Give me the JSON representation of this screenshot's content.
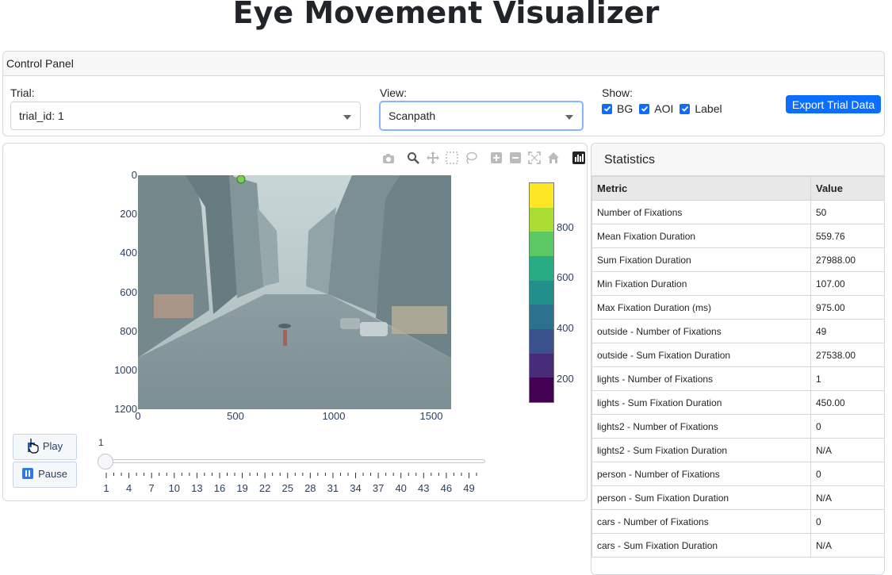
{
  "app": {
    "title": "Eye Movement Visualizer"
  },
  "control_panel": {
    "header": "Control Panel",
    "trial": {
      "label": "Trial:",
      "value": "trial_id: 1"
    },
    "view": {
      "label": "View:",
      "value": "Scanpath"
    },
    "show": {
      "label": "Show:",
      "options": [
        {
          "label": "BG",
          "checked": true
        },
        {
          "label": "AOI",
          "checked": true
        },
        {
          "label": "Label",
          "checked": true
        }
      ]
    },
    "export_label": "Export Trial Data"
  },
  "plot": {
    "modebar_icons": [
      "camera-icon",
      "zoom-icon",
      "pan-icon",
      "box-select-icon",
      "lasso-icon",
      "zoom-in-icon",
      "zoom-out-icon",
      "autoscale-icon",
      "reset-icon",
      "plotly-logo-icon"
    ],
    "y_ticks": [
      "0",
      "200",
      "400",
      "600",
      "800",
      "1000",
      "1200"
    ],
    "x_ticks": [
      "0",
      "500",
      "1000",
      "1500"
    ],
    "colorbar_ticks": [
      "800",
      "600",
      "400",
      "200"
    ],
    "colorbar_colors": [
      "#440154",
      "#472c7a",
      "#3b518b",
      "#2c718e",
      "#21908d",
      "#27ad81",
      "#5cc863",
      "#aadc32",
      "#fde725"
    ],
    "background": "street scene image",
    "marker_color": "#7ad151"
  },
  "animation": {
    "play_label": "Play",
    "pause_label": "Pause",
    "slider_current": "1",
    "slider_value": 1,
    "slider_min": 1,
    "slider_max": 50,
    "slider_labels": [
      "1",
      "4",
      "7",
      "10",
      "13",
      "16",
      "19",
      "22",
      "25",
      "28",
      "31",
      "34",
      "37",
      "40",
      "43",
      "46",
      "49"
    ]
  },
  "statistics": {
    "title": "Statistics",
    "columns": [
      "Metric",
      "Value"
    ],
    "rows": [
      [
        "Number of Fixations",
        "50"
      ],
      [
        "Mean Fixation Duration",
        "559.76"
      ],
      [
        "Sum Fixation Duration",
        "27988.00"
      ],
      [
        "Min Fixation Duration",
        "107.00"
      ],
      [
        "Max Fixation Duration (ms)",
        "975.00"
      ],
      [
        "outside - Number of Fixations",
        "49"
      ],
      [
        "outside - Sum Fixation Duration",
        "27538.00"
      ],
      [
        "lights - Number of Fixations",
        "1"
      ],
      [
        "lights - Sum Fixation Duration",
        "450.00"
      ],
      [
        "lights2 - Number of Fixations",
        "0"
      ],
      [
        "lights2 - Sum Fixation Duration",
        "N/A"
      ],
      [
        "person - Number of Fixations",
        "0"
      ],
      [
        "person - Sum Fixation Duration",
        "N/A"
      ],
      [
        "cars - Number of Fixations",
        "0"
      ],
      [
        "cars - Sum Fixation Duration",
        "N/A"
      ]
    ]
  }
}
